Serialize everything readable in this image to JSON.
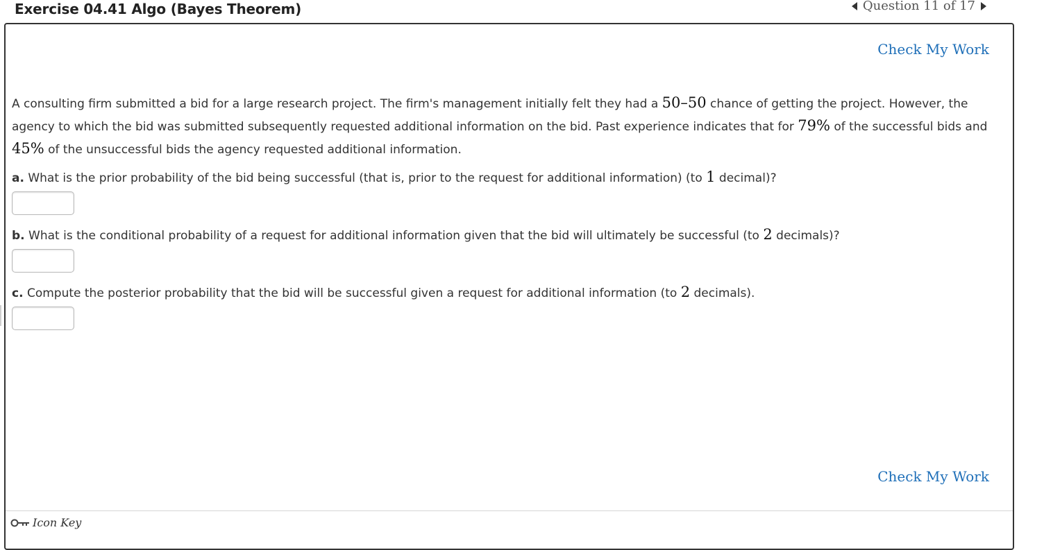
{
  "header": {
    "title": "Exercise 04.41 Algo (Bayes Theorem)",
    "question_nav": "Question 11 of 17"
  },
  "links": {
    "check_my_work": "Check My Work"
  },
  "problem": {
    "intro_1": "A consulting firm submitted a bid for a large research project. The firm's management initially felt they had a ",
    "chance": "50–50",
    "intro_2": " chance of getting the project. However, the agency to which the bid was submitted subsequently requested additional information on the bid. Past experience indicates that for ",
    "pct_successful": "79%",
    "intro_3": " of the successful bids and ",
    "pct_unsuccessful": "45%",
    "intro_4": " of the unsuccessful bids the agency requested additional information."
  },
  "questions": [
    {
      "label": "a.",
      "text_1": " What is the prior probability of the bid being successful (that is, prior to the request for additional information) (to ",
      "num": "1",
      "text_2": " decimal)?",
      "answer": ""
    },
    {
      "label": "b.",
      "text_1": " What is the conditional probability of a request for additional information given that the bid will ultimately be successful (to ",
      "num": "2",
      "text_2": " decimals)?",
      "answer": ""
    },
    {
      "label": "c.",
      "text_1": " Compute the posterior probability that the bid will be successful given a request for additional information (to ",
      "num": "2",
      "text_2": " decimals).",
      "answer": ""
    }
  ],
  "footer": {
    "icon_key_label": "Icon Key",
    "icon": "key-icon"
  }
}
